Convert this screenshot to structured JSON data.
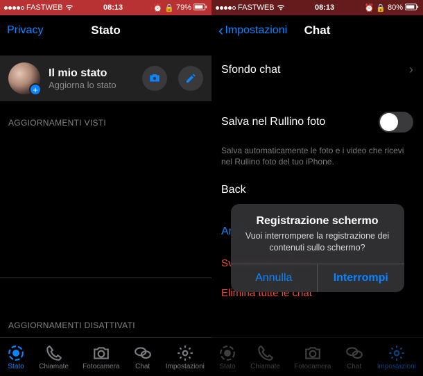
{
  "left": {
    "status_bar": {
      "carrier": "FASTWEB",
      "wifi_icon": "wifi-icon",
      "time": "08:13",
      "alarm_icon": "alarm-icon",
      "rotation_lock_icon": "rotation-lock-icon",
      "battery_pct": "79%",
      "battery_icon": "battery-icon"
    },
    "nav": {
      "back": "Privacy",
      "title": "Stato"
    },
    "my_status": {
      "title": "Il mio stato",
      "subtitle": "Aggiorna lo stato",
      "camera_icon": "camera-icon",
      "edit_icon": "pencil-icon",
      "avatar_plus_icon": "plus-icon"
    },
    "sections": {
      "seen": "AGGIORNAMENTI VISTI",
      "muted": "AGGIORNAMENTI DISATTIVATI"
    },
    "tabs": [
      {
        "label": "Stato",
        "icon": "status-ring-icon",
        "active": true
      },
      {
        "label": "Chiamate",
        "icon": "phone-icon",
        "active": false
      },
      {
        "label": "Fotocamera",
        "icon": "camera-icon",
        "active": false
      },
      {
        "label": "Chat",
        "icon": "chat-bubbles-icon",
        "active": false
      },
      {
        "label": "Impostazioni",
        "icon": "gear-icon",
        "active": false
      }
    ]
  },
  "right": {
    "status_bar": {
      "carrier": "FASTWEB",
      "time": "08:13",
      "battery_pct": "80%"
    },
    "nav": {
      "back": "Impostazioni",
      "title": "Chat"
    },
    "rows": {
      "background": "Sfondo chat",
      "save_roll": "Salva nel Rullino foto",
      "save_roll_desc": "Salva automaticamente le foto e i video che ricevi nel Rullino foto del tuo iPhone.",
      "backup": "Back",
      "archive": "Archi",
      "clear_all": "Svuota tutte le chat",
      "delete_all": "Elimina tutte le chat"
    },
    "alert": {
      "title": "Registrazione schermo",
      "message": "Vuoi interrompere la registrazione dei contenuti sullo schermo?",
      "cancel": "Annulla",
      "confirm": "Interrompi"
    },
    "tabs": [
      {
        "label": "Stato",
        "icon": "status-ring-icon",
        "active": false
      },
      {
        "label": "Chiamate",
        "icon": "phone-icon",
        "active": false
      },
      {
        "label": "Fotocamera",
        "icon": "camera-icon",
        "active": false
      },
      {
        "label": "Chat",
        "icon": "chat-bubbles-icon",
        "active": false
      },
      {
        "label": "Impostazioni",
        "icon": "gear-icon",
        "active": true
      }
    ]
  },
  "colors": {
    "accent": "#0a84ff",
    "danger": "#eb4d3d",
    "recording": "#b83133"
  }
}
